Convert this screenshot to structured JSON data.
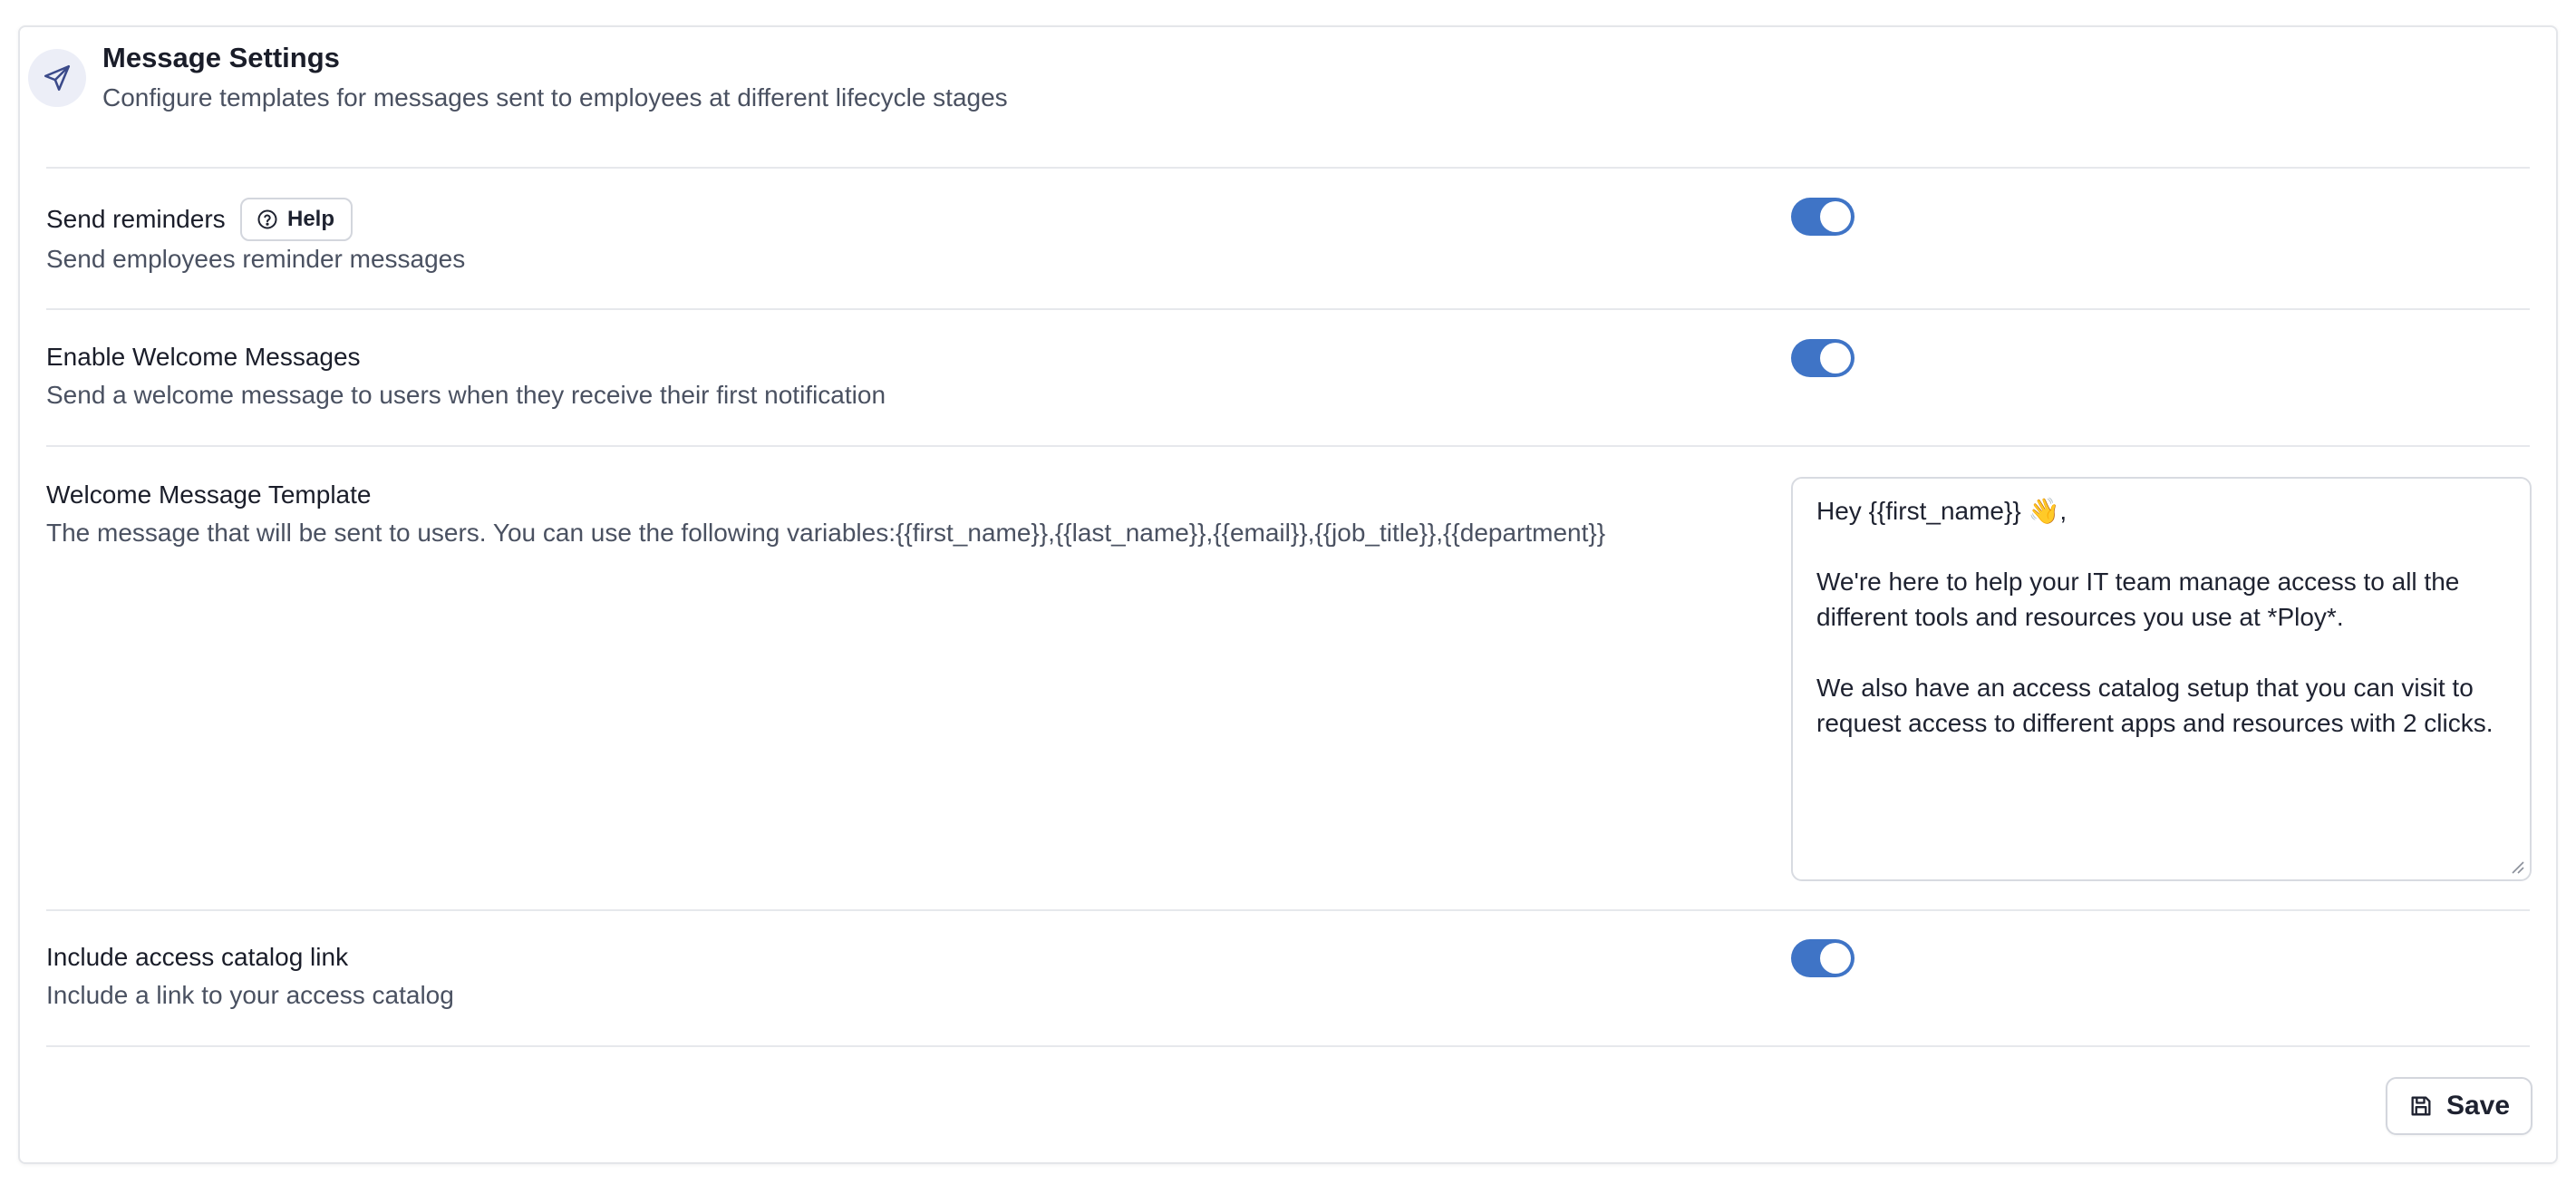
{
  "header": {
    "title": "Message Settings",
    "subtitle": "Configure templates for messages sent to employees at different lifecycle stages",
    "icon": "send-icon"
  },
  "send_reminders": {
    "label": "Send reminders",
    "help_label": "Help",
    "description": "Send employees reminder messages",
    "enabled": true
  },
  "welcome_messages": {
    "label": "Enable Welcome Messages",
    "description": "Send a welcome message to users when they receive their first notification",
    "enabled": true
  },
  "welcome_template": {
    "label": "Welcome Message Template",
    "description": "The message that will be sent to users. You can use the following variables:{{first_name}},{{last_name}},{{email}},{{job_title}},{{department}}",
    "value": "Hey {{first_name}} 👋,\n\nWe're here to help your IT team manage access to all the different tools and resources you use at *Ploy*.\n\nWe also have an access catalog setup that you can visit to request access to different apps and resources with 2 clicks."
  },
  "catalog_link": {
    "label": "Include access catalog link",
    "description": "Include a link to your access catalog",
    "enabled": true
  },
  "footer": {
    "save_label": "Save"
  },
  "colors": {
    "toggle_on": "#3f74c6",
    "border": "#e4e6ea",
    "icon_bg": "#eceef7"
  }
}
